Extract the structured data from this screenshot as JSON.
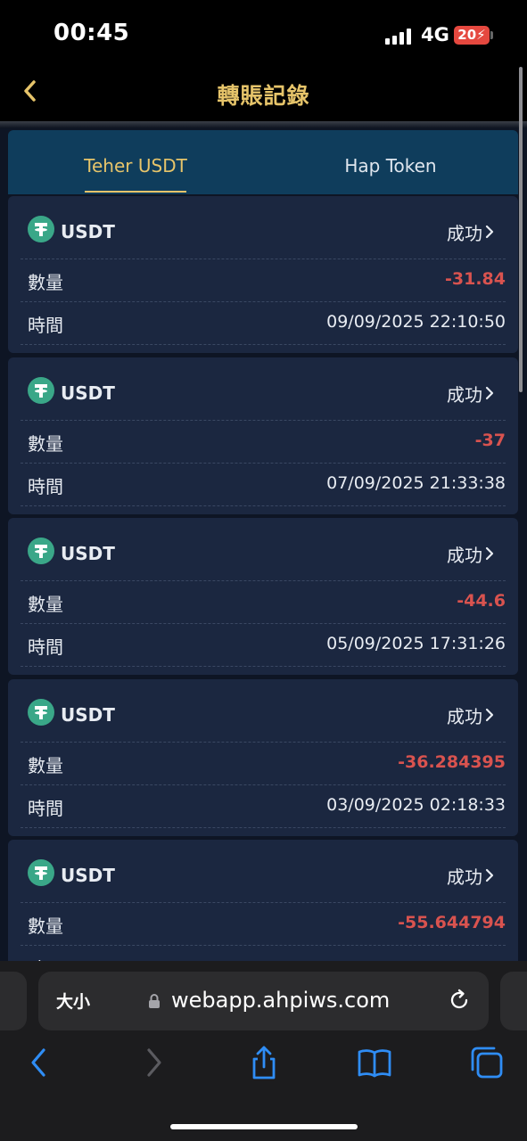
{
  "status_bar": {
    "time": "00:45",
    "network": "4G",
    "battery": "20"
  },
  "header": {
    "title": "轉賬記錄"
  },
  "tabs": [
    {
      "label": "Teher USDT",
      "active": true
    },
    {
      "label": "Hap Token",
      "active": false
    }
  ],
  "records": [
    {
      "coin": "USDT",
      "status": "成功",
      "amount_label": "數量",
      "amount": "-31.84",
      "time_label": "時間",
      "time": "09/09/2025 22:10:50"
    },
    {
      "coin": "USDT",
      "status": "成功",
      "amount_label": "數量",
      "amount": "-37",
      "time_label": "時間",
      "time": "07/09/2025 21:33:38"
    },
    {
      "coin": "USDT",
      "status": "成功",
      "amount_label": "數量",
      "amount": "-44.6",
      "time_label": "時間",
      "time": "05/09/2025 17:31:26"
    },
    {
      "coin": "USDT",
      "status": "成功",
      "amount_label": "數量",
      "amount": "-36.284395",
      "time_label": "時間",
      "time": "03/09/2025 02:18:33"
    },
    {
      "coin": "USDT",
      "status": "成功",
      "amount_label": "數量",
      "amount": "-55.644794",
      "time_label": "時間",
      "time": ""
    }
  ],
  "browser": {
    "text_size_label": "大小",
    "url": "webapp.ahpiws.com"
  },
  "colors": {
    "accent": "#e6c46a",
    "negative": "#d9534f",
    "card": "#1b2740",
    "tab_bar": "#0f3d5c"
  }
}
